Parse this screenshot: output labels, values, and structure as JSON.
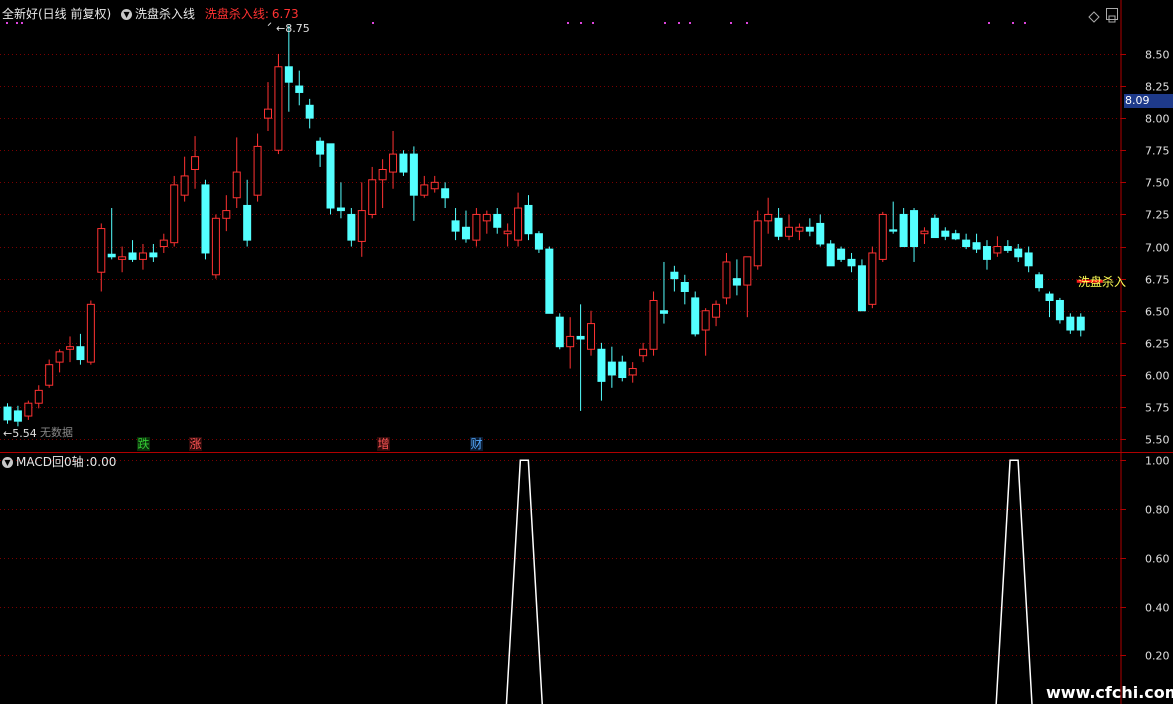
{
  "header": {
    "stock_title": "全新好(日线 前复权)",
    "indicator_name": "洗盘杀入线",
    "indicator_label": "洗盘杀入线:",
    "indicator_value": "6.73"
  },
  "sub_header": {
    "name": "MACD回0轴",
    "value_text": ":0.00"
  },
  "current_price": "8.09",
  "annotations": {
    "high": "8.75",
    "low": "5.54",
    "right_label": "洗盘杀入",
    "no_data": "无数据"
  },
  "events": [
    {
      "label": "跌",
      "color": "#33cc33",
      "bg": "#0a300a",
      "idx": 13
    },
    {
      "label": "涨",
      "color": "#ff5555",
      "bg": "#300a0a",
      "idx": 18
    },
    {
      "label": "增",
      "color": "#ff5555",
      "bg": "#300a0a",
      "idx": 36
    },
    {
      "label": "财",
      "color": "#55aaff",
      "bg": "#0a1a30",
      "idx": 45
    }
  ],
  "watermark": "www.cfchi.com",
  "colors": {
    "up": "#ff3232",
    "down": "#54ffff",
    "axis_red": "#b00000",
    "grid": "#7a0000"
  },
  "chart_data": [
    {
      "type": "candlestick",
      "title": "全新好(日线 前复权)",
      "ylim": [
        5.4,
        8.92
      ],
      "y_ticks": [
        5.5,
        5.75,
        6.0,
        6.25,
        6.5,
        6.75,
        7.0,
        7.25,
        7.5,
        7.75,
        8.0,
        8.25,
        8.5
      ],
      "y_tick_labels": [
        "5.50",
        "5.75",
        "6.00",
        "6.25",
        "6.50",
        "6.75",
        "7.00",
        "7.25",
        "7.50",
        "7.75",
        "8.00",
        "8.25",
        "8.50"
      ],
      "ohlc": [
        [
          5.75,
          5.78,
          5.62,
          5.65
        ],
        [
          5.72,
          5.76,
          5.6,
          5.64
        ],
        [
          5.68,
          5.8,
          5.65,
          5.78
        ],
        [
          5.78,
          5.92,
          5.74,
          5.88
        ],
        [
          5.92,
          6.12,
          5.9,
          6.08
        ],
        [
          6.1,
          6.2,
          6.02,
          6.18
        ],
        [
          6.2,
          6.3,
          6.1,
          6.22
        ],
        [
          6.22,
          6.32,
          6.08,
          6.12
        ],
        [
          6.1,
          6.58,
          6.08,
          6.55
        ],
        [
          6.8,
          7.18,
          6.65,
          7.14
        ],
        [
          6.94,
          7.3,
          6.9,
          6.92
        ],
        [
          6.9,
          7.0,
          6.8,
          6.92
        ],
        [
          6.95,
          7.05,
          6.88,
          6.9
        ],
        [
          6.9,
          7.02,
          6.82,
          6.95
        ],
        [
          6.95,
          7.02,
          6.88,
          6.92
        ],
        [
          7.0,
          7.1,
          6.95,
          7.05
        ],
        [
          7.03,
          7.55,
          7.0,
          7.48
        ],
        [
          7.4,
          7.7,
          7.35,
          7.55
        ],
        [
          7.6,
          7.86,
          7.45,
          7.7
        ],
        [
          7.48,
          7.52,
          6.9,
          6.95
        ],
        [
          6.78,
          7.25,
          6.75,
          7.22
        ],
        [
          7.22,
          7.4,
          7.12,
          7.28
        ],
        [
          7.38,
          7.85,
          7.3,
          7.58
        ],
        [
          7.32,
          7.52,
          7.0,
          7.05
        ],
        [
          7.4,
          7.88,
          7.35,
          7.78
        ],
        [
          8.0,
          8.28,
          7.9,
          8.07
        ],
        [
          7.75,
          8.5,
          7.72,
          8.4
        ],
        [
          8.4,
          8.72,
          8.05,
          8.28
        ],
        [
          8.25,
          8.37,
          8.1,
          8.2
        ],
        [
          8.1,
          8.15,
          7.92,
          8.0
        ],
        [
          7.82,
          7.85,
          7.62,
          7.72
        ],
        [
          7.8,
          7.8,
          7.25,
          7.3
        ],
        [
          7.3,
          7.5,
          7.22,
          7.28
        ],
        [
          7.25,
          7.3,
          7.0,
          7.05
        ],
        [
          7.04,
          7.5,
          6.92,
          7.28
        ],
        [
          7.25,
          7.62,
          7.22,
          7.52
        ],
        [
          7.52,
          7.68,
          7.3,
          7.6
        ],
        [
          7.58,
          7.9,
          7.45,
          7.72
        ],
        [
          7.72,
          7.75,
          7.55,
          7.58
        ],
        [
          7.72,
          7.78,
          7.2,
          7.4
        ],
        [
          7.4,
          7.55,
          7.38,
          7.48
        ],
        [
          7.45,
          7.55,
          7.42,
          7.5
        ],
        [
          7.45,
          7.5,
          7.3,
          7.38
        ],
        [
          7.2,
          7.3,
          7.05,
          7.12
        ],
        [
          7.15,
          7.28,
          7.03,
          7.06
        ],
        [
          7.05,
          7.3,
          7.0,
          7.25
        ],
        [
          7.2,
          7.28,
          7.1,
          7.25
        ],
        [
          7.25,
          7.3,
          7.1,
          7.15
        ],
        [
          7.1,
          7.18,
          7.0,
          7.12
        ],
        [
          7.05,
          7.42,
          7.0,
          7.3
        ],
        [
          7.32,
          7.4,
          7.05,
          7.1
        ],
        [
          7.1,
          7.12,
          6.95,
          6.98
        ],
        [
          6.98,
          7.0,
          6.5,
          6.48
        ],
        [
          6.45,
          6.48,
          6.2,
          6.22
        ],
        [
          6.22,
          6.45,
          6.05,
          6.3
        ],
        [
          6.3,
          6.55,
          5.72,
          6.28
        ],
        [
          6.2,
          6.5,
          6.15,
          6.4
        ],
        [
          6.2,
          6.25,
          5.8,
          5.95
        ],
        [
          6.1,
          6.22,
          5.9,
          6.0
        ],
        [
          6.1,
          6.15,
          5.95,
          5.98
        ],
        [
          6.0,
          6.1,
          5.94,
          6.05
        ],
        [
          6.15,
          6.25,
          6.1,
          6.2
        ],
        [
          6.2,
          6.65,
          6.15,
          6.58
        ],
        [
          6.5,
          6.88,
          6.4,
          6.48
        ],
        [
          6.8,
          6.85,
          6.65,
          6.75
        ],
        [
          6.72,
          6.78,
          6.55,
          6.65
        ],
        [
          6.6,
          6.65,
          6.3,
          6.32
        ],
        [
          6.35,
          6.52,
          6.15,
          6.5
        ],
        [
          6.45,
          6.58,
          6.38,
          6.55
        ],
        [
          6.6,
          6.95,
          6.55,
          6.88
        ],
        [
          6.75,
          6.9,
          6.62,
          6.7
        ],
        [
          6.7,
          6.9,
          6.45,
          6.92
        ],
        [
          6.85,
          7.28,
          6.82,
          7.2
        ],
        [
          7.2,
          7.38,
          7.1,
          7.25
        ],
        [
          7.22,
          7.3,
          7.05,
          7.08
        ],
        [
          7.08,
          7.25,
          7.05,
          7.15
        ],
        [
          7.12,
          7.18,
          7.05,
          7.15
        ],
        [
          7.15,
          7.22,
          7.08,
          7.12
        ],
        [
          7.18,
          7.25,
          7.0,
          7.02
        ],
        [
          7.02,
          7.05,
          6.85,
          6.85
        ],
        [
          6.98,
          7.0,
          6.88,
          6.9
        ],
        [
          6.9,
          6.95,
          6.8,
          6.85
        ],
        [
          6.85,
          6.9,
          6.5,
          6.5
        ],
        [
          6.55,
          7.0,
          6.52,
          6.95
        ],
        [
          6.9,
          7.27,
          6.88,
          7.25
        ],
        [
          7.13,
          7.35,
          7.1,
          7.12
        ],
        [
          7.25,
          7.3,
          7.0,
          7.0
        ],
        [
          7.28,
          7.3,
          6.88,
          7.0
        ],
        [
          7.1,
          7.15,
          7.02,
          7.12
        ],
        [
          7.22,
          7.25,
          7.08,
          7.07
        ],
        [
          7.12,
          7.15,
          7.05,
          7.08
        ],
        [
          7.1,
          7.13,
          7.05,
          7.06
        ],
        [
          7.05,
          7.1,
          6.98,
          7.0
        ],
        [
          7.03,
          7.1,
          6.95,
          6.98
        ],
        [
          7.0,
          7.05,
          6.82,
          6.9
        ],
        [
          6.95,
          7.08,
          6.92,
          7.0
        ],
        [
          7.0,
          7.05,
          6.95,
          6.97
        ],
        [
          6.98,
          7.02,
          6.88,
          6.92
        ],
        [
          6.95,
          7.0,
          6.8,
          6.85
        ],
        [
          6.78,
          6.8,
          6.65,
          6.68
        ],
        [
          6.63,
          6.65,
          6.45,
          6.58
        ],
        [
          6.58,
          6.6,
          6.4,
          6.43
        ],
        [
          6.45,
          6.48,
          6.32,
          6.35
        ],
        [
          6.45,
          6.48,
          6.3,
          6.35
        ]
      ],
      "overlay_line": {
        "name": "洗盘杀入线",
        "value": 6.73,
        "start_idx": 103
      }
    },
    {
      "type": "line",
      "title": "MACD回0轴",
      "ylim": [
        0,
        1.03
      ],
      "y_ticks": [
        0.2,
        0.4,
        0.6,
        0.8,
        1.0
      ],
      "y_tick_labels": [
        "0.20",
        "0.40",
        "0.60",
        "0.80",
        "1.00"
      ],
      "spikes_at_idx": [
        52,
        99
      ]
    }
  ]
}
